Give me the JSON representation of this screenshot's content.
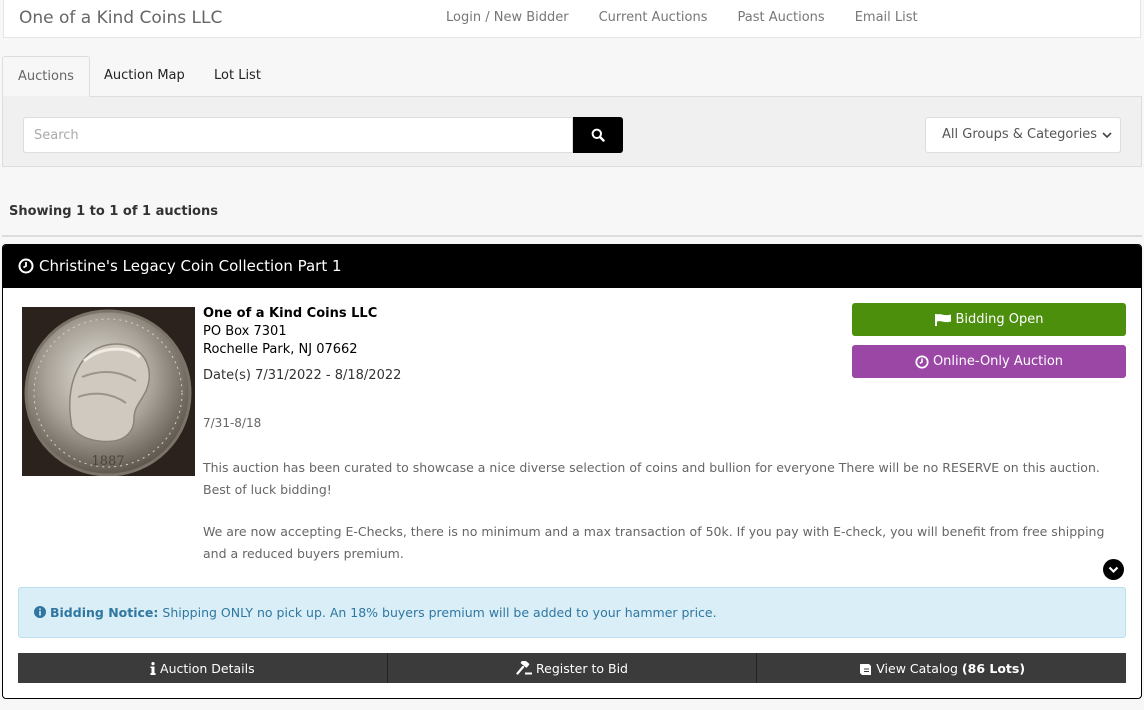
{
  "header": {
    "brand": "One of a Kind Coins LLC",
    "nav": [
      "Login / New Bidder",
      "Current Auctions",
      "Past Auctions",
      "Email List"
    ]
  },
  "tabs": [
    "Auctions",
    "Auction Map",
    "Lot List"
  ],
  "search": {
    "placeholder": "Search",
    "value": "",
    "category": "All Groups & Categories"
  },
  "results": {
    "showing_prefix": "Showing ",
    "from": "1",
    "to_word": " to ",
    "to": "1",
    "of_word": " of ",
    "total": "1",
    "suffix": " auctions"
  },
  "auction": {
    "title": "Christine's Legacy Coin Collection Part 1",
    "seller": "One of a Kind Coins LLC",
    "address1": "PO Box 7301",
    "address2": "Rochelle Park, NJ 07662",
    "dates": "Date(s) 7/31/2022 - 8/18/2022",
    "range": "7/31-8/18",
    "desc1": "This auction has been curated to showcase a nice diverse selection of coins and bullion for everyone There will be no RESERVE on this auction. Best of luck bidding!",
    "desc2": "We are now accepting E-Checks, there is no minimum and a max transaction of 50k. If you pay with E-check, you will benefit from free shipping and a reduced buyers premium.",
    "status": "Bidding Open",
    "type": "Online-Only Auction",
    "coin_year": "1887",
    "notice_label": "Bidding Notice:",
    "notice_text": "Shipping ONLY no pick up. An 18% buyers premium will be added to your hammer price.",
    "details_label": "Auction Details",
    "register_label": "Register to Bid",
    "catalog_label": "View Catalog",
    "catalog_count": "(86 Lots)"
  },
  "colors": {
    "status_green": "#4b8f0c",
    "online_purple": "#9b47a6",
    "notice_bg": "#d9eef7"
  }
}
